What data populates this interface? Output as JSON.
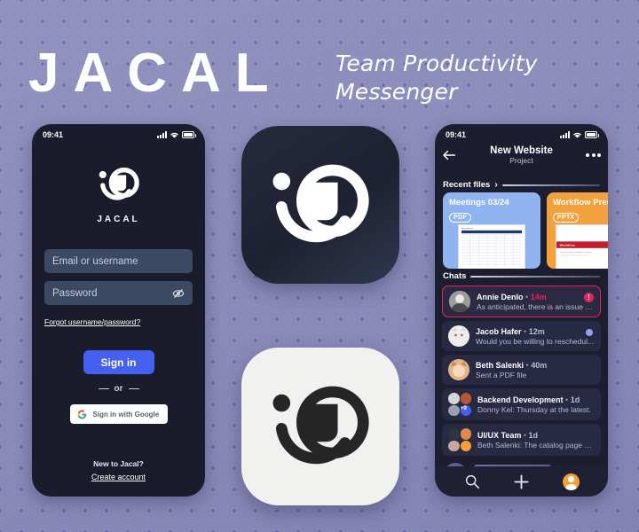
{
  "brand": {
    "wordmark": "JACAL",
    "tagline_line1": "Team Productivity",
    "tagline_line2": "Messenger",
    "logo_label": "JACAL",
    "accent_blue": "#4560f0",
    "accent_red": "#e6235a",
    "background": "#8b8cbb",
    "dot_color": "#5a5ca8"
  },
  "login_screen": {
    "status_bar": {
      "time": "09:41",
      "signal_icon": "signal-bars-icon",
      "wifi_icon": "wifi-icon",
      "battery_icon": "battery-icon"
    },
    "logo_name": "JACAL",
    "email_field": {
      "placeholder": "Email or username",
      "value": ""
    },
    "password_field": {
      "placeholder": "Password",
      "value": "",
      "reveal_icon": "eye-off-icon"
    },
    "forgot_link": "Forgot username/password?",
    "signin_button": "Sign in",
    "divider_label": "or",
    "google_button": {
      "label": "Sign in with Google",
      "icon": "google-g-icon"
    },
    "footer_question": "New to Jacal?",
    "create_account_link": "Create account"
  },
  "logo_tiles": [
    {
      "name": "dark-app-icon",
      "background": "#262a3d",
      "mark_color": "#ffffff"
    },
    {
      "name": "light-app-icon",
      "background": "#f1f1f0",
      "mark_color": "#262626"
    }
  ],
  "chat_screen": {
    "status_bar": {
      "time": "09:41",
      "signal_icon": "signal-bars-icon",
      "wifi_icon": "wifi-icon",
      "battery_icon": "battery-icon"
    },
    "back_icon": "back-arrow-icon",
    "more_icon": "more-options-icon",
    "title": "New Website",
    "subtitle": "Project",
    "recent_files_label": "Recent files",
    "recent_files_chevron": "›",
    "files": [
      {
        "name": "Meetings 03/24",
        "type": "PDF",
        "card_color": "#8fb4ef",
        "thumb": "spreadsheet"
      },
      {
        "name": "Workflow Presentation",
        "type": "PPTX",
        "card_color": "#f2a13c",
        "thumb": "slide"
      }
    ],
    "chats_label": "Chats",
    "chats": [
      {
        "name": "Annie Denlo",
        "time": "14m",
        "preview": "As anticipated, there is an issue w...",
        "selected": true,
        "badge": "!",
        "badge_type": "alert",
        "avatar_type": "single",
        "avatar_color": "#c9c9c9"
      },
      {
        "name": "Jacob Hafer",
        "time": "12m",
        "preview": "Would you be willing to reschedul...",
        "selected": false,
        "badge": "",
        "badge_type": "unread-dot",
        "avatar_type": "single",
        "avatar_color": "#e8e8e8"
      },
      {
        "name": "Beth Salenki",
        "time": "40m",
        "preview": "Sent a PDF file",
        "selected": false,
        "badge": "",
        "badge_type": "none",
        "avatar_type": "single",
        "avatar_color": "#e2a070"
      },
      {
        "name": "Backend Development",
        "time": "1d",
        "preview": "Donny Kel: Thursday at the latest.",
        "selected": false,
        "badge": "",
        "badge_type": "none",
        "avatar_type": "group",
        "group_extra": "+9",
        "group_colors": [
          "#d6d6d6",
          "#b4582f",
          "#9aa0b4",
          "#4560f0"
        ]
      },
      {
        "name": "UI/UX Team",
        "time": "1d",
        "preview": "Beth Salenki: The catalog page cou...",
        "selected": false,
        "badge": "",
        "badge_type": "none",
        "avatar_type": "group",
        "group_extra": "",
        "group_colors": [
          "#2f3340",
          "#e0884c",
          "#c6a79a",
          "#f2a13c"
        ]
      }
    ],
    "tabs": [
      {
        "name": "search",
        "icon": "search-icon"
      },
      {
        "name": "new",
        "icon": "plus-icon"
      },
      {
        "name": "profile",
        "icon": "avatar-icon"
      }
    ]
  }
}
